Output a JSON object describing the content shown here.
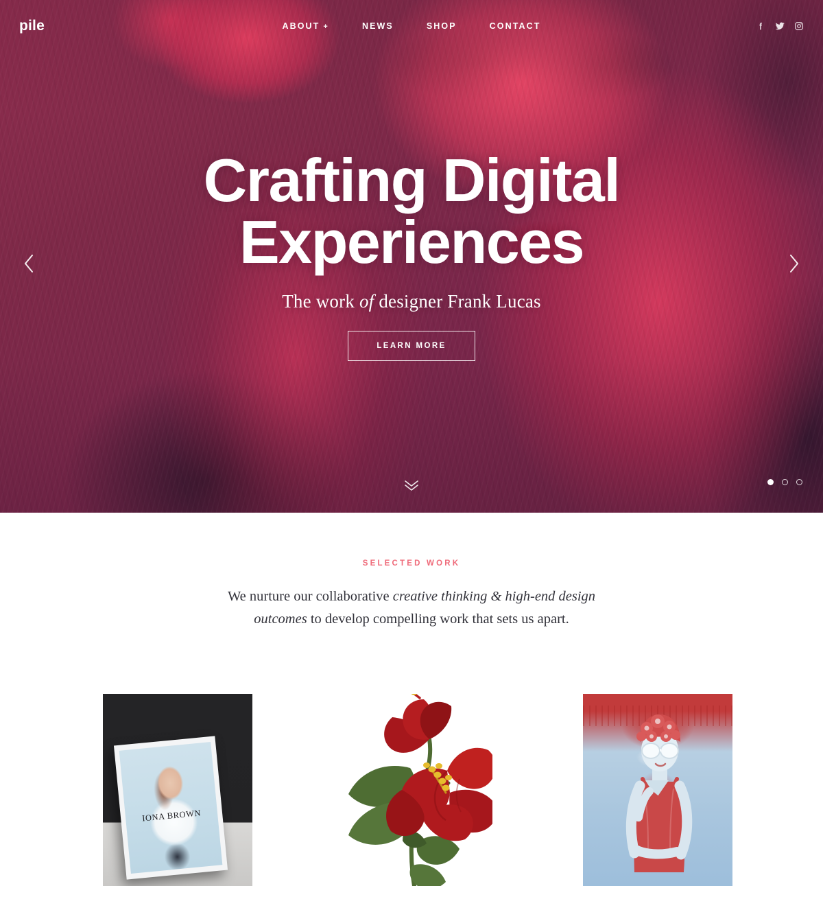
{
  "header": {
    "brand": "pile",
    "nav": [
      {
        "label": "ABOUT",
        "has_submenu": true,
        "submenu_glyph": "+"
      },
      {
        "label": "NEWS",
        "has_submenu": false
      },
      {
        "label": "SHOP",
        "has_submenu": false
      },
      {
        "label": "CONTACT",
        "has_submenu": false
      }
    ],
    "social": [
      {
        "name": "facebook-icon",
        "label": "Facebook"
      },
      {
        "name": "twitter-icon",
        "label": "Twitter"
      },
      {
        "name": "instagram-icon",
        "label": "Instagram"
      }
    ]
  },
  "hero": {
    "title_line1": "Crafting Digital",
    "title_line2": "Experiences",
    "subtitle_before": "The work ",
    "subtitle_italic": "of",
    "subtitle_after": " designer Frank Lucas",
    "cta_label": "LEARN MORE",
    "prev_label": "Previous slide",
    "next_label": "Next slide",
    "scroll_label": "Scroll down",
    "slides_total": 3,
    "slide_active_index": 1,
    "background_color": "#7d2a45",
    "accent_color": "#e8436b"
  },
  "work": {
    "eyebrow": "SELECTED WORK",
    "eyebrow_color": "#ef6b7a",
    "intro_before": "We nurture our collaborative ",
    "intro_italic": "creative thinking & high-end design outcomes",
    "intro_after": " to develop compelling work that sets us apart.",
    "items": [
      {
        "name": "magazine-mockup",
        "cover_title": "IONA BROWN"
      },
      {
        "name": "hibiscus-illustration",
        "cover_title": ""
      },
      {
        "name": "poolside-portrait",
        "cover_title": ""
      }
    ]
  }
}
